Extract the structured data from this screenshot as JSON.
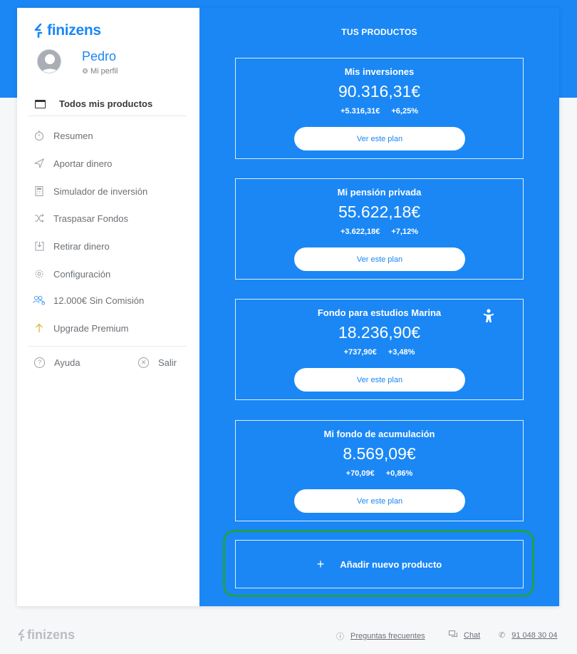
{
  "brand": {
    "name": "finizens",
    "color": "#1a87f5"
  },
  "profile": {
    "name": "Pedro",
    "link": "Mi perfil"
  },
  "sidebar": {
    "all_products": "Todos mis productos",
    "items": [
      {
        "label": "Resumen",
        "icon": "stopwatch-icon"
      },
      {
        "label": "Aportar dinero",
        "icon": "send-icon"
      },
      {
        "label": "Simulador de inversión",
        "icon": "calculator-icon"
      },
      {
        "label": "Traspasar Fondos",
        "icon": "shuffle-icon"
      },
      {
        "label": "Retirar dinero",
        "icon": "withdraw-icon"
      },
      {
        "label": "Configuración",
        "icon": "gear-icon"
      },
      {
        "label": "12.000€ Sin Comisión",
        "icon": "people-icon"
      },
      {
        "label": "Upgrade Premium",
        "icon": "arrow-up-icon"
      }
    ],
    "help": "Ayuda",
    "logout": "Salir"
  },
  "main": {
    "title": "TUS PRODUCTOS",
    "products": [
      {
        "name": "Mis inversiones",
        "value": "90.316,31€",
        "gain": "+5.316,31€",
        "pct": "+6,25%",
        "button": "Ver este plan",
        "child_icon": false
      },
      {
        "name": "Mi pensión privada",
        "value": "55.622,18€",
        "gain": "+3.622,18€",
        "pct": "+7,12%",
        "button": "Ver este plan",
        "child_icon": false
      },
      {
        "name": "Fondo para estudios Marina",
        "value": "18.236,90€",
        "gain": "+737,90€",
        "pct": "+3,48%",
        "button": "Ver este plan",
        "child_icon": true
      },
      {
        "name": "Mi fondo de acumulación",
        "value": "8.569,09€",
        "gain": "+70,09€",
        "pct": "+0,86%",
        "button": "Ver este plan",
        "child_icon": false
      }
    ],
    "add_product": {
      "plus": "+",
      "label": "Añadir nuevo producto"
    }
  },
  "footer": {
    "faq": "Preguntas frecuentes",
    "chat": "Chat",
    "phone": "91 048 30 04"
  },
  "colors": {
    "accent": "#1a87f5",
    "highlight": "#22a04b"
  }
}
